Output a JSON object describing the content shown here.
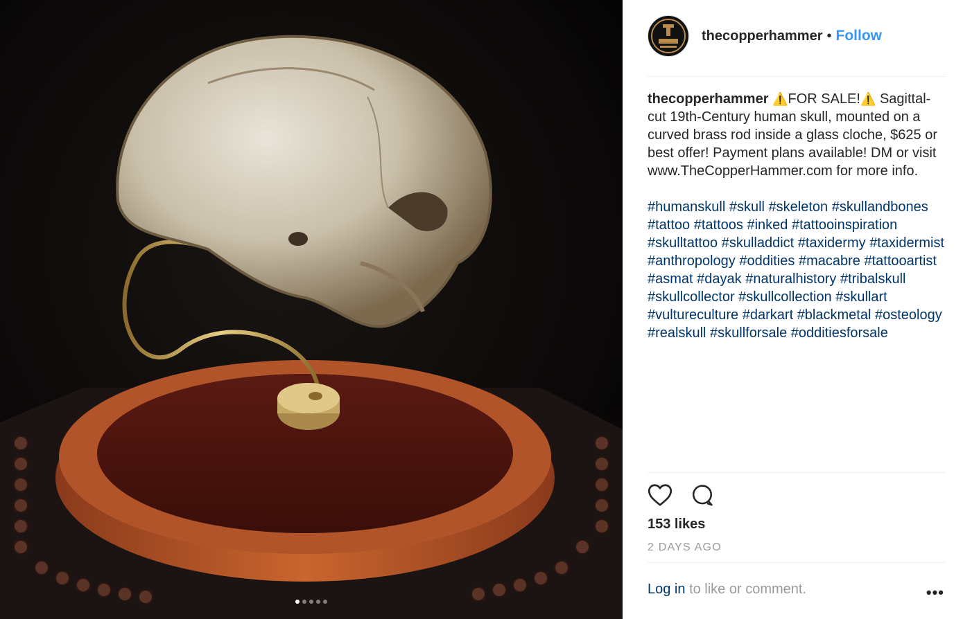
{
  "post": {
    "username": "thecopperhammer",
    "follow_label": "Follow",
    "separator": "•",
    "avatar_text": "COPPER HAMMER",
    "caption_user": "thecopperhammer",
    "caption_warn_icon": "⚠️",
    "caption_headline": "FOR SALE!",
    "caption_body": "Sagittal-cut 19th-Century human skull, mounted on a curved brass rod inside a glass cloche, $625 or best offer! Payment plans available! DM or visit www.TheCopperHammer.com for more info.",
    "hashtags": [
      "#humanskull",
      "#skull",
      "#skeleton",
      "#skullandbones",
      "#tattoo",
      "#tattoos",
      "#inked",
      "#tattooinspiration",
      "#skulltattoo",
      "#skulladdict",
      "#taxidermy",
      "#taxidermist",
      "#anthropology",
      "#oddities",
      "#macabre",
      "#tattooartist",
      "#asmat",
      "#dayak",
      "#naturalhistory",
      "#tribalskull",
      "#skullcollector",
      "#skullcollection",
      "#skullart",
      "#vultureculture",
      "#darkart",
      "#blackmetal",
      "#osteology",
      "#realskull",
      "#skullforsale",
      "#odditiesforsale"
    ],
    "likes": "153 likes",
    "age": "2 DAYS AGO",
    "login_link": "Log in",
    "login_suffix": "to like or comment.",
    "more_label": "•••",
    "carousel_count": 5,
    "carousel_active": 0
  },
  "icons": {
    "like": "heart-icon",
    "comment": "comment-icon"
  },
  "colors": {
    "follow": "#3897f0",
    "hashtag": "#003569",
    "muted": "#999999"
  }
}
